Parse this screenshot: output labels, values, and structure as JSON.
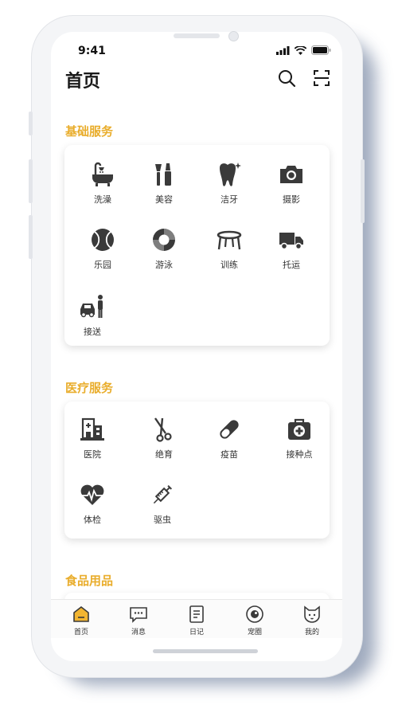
{
  "status_bar": {
    "time": "9:41"
  },
  "header": {
    "title": "首页",
    "icons": [
      "search-icon",
      "scan-icon"
    ]
  },
  "sections": [
    {
      "title": "基础服务",
      "items": [
        {
          "label": "洗澡",
          "icon": "bath-icon"
        },
        {
          "label": "美容",
          "icon": "beauty-icon"
        },
        {
          "label": "洁牙",
          "icon": "tooth-icon"
        },
        {
          "label": "摄影",
          "icon": "camera-icon"
        },
        {
          "label": "乐园",
          "icon": "ball-icon"
        },
        {
          "label": "游泳",
          "icon": "swim-ring-icon"
        },
        {
          "label": "训练",
          "icon": "trampoline-icon"
        },
        {
          "label": "托运",
          "icon": "truck-icon"
        },
        {
          "label": "接送",
          "icon": "pickup-icon"
        }
      ]
    },
    {
      "title": "医疗服务",
      "items": [
        {
          "label": "医院",
          "icon": "hospital-icon"
        },
        {
          "label": "绝育",
          "icon": "scissors-icon"
        },
        {
          "label": "疫苗",
          "icon": "pill-icon"
        },
        {
          "label": "接种点",
          "icon": "medkit-icon"
        },
        {
          "label": "体检",
          "icon": "heartbeat-icon"
        },
        {
          "label": "驱虫",
          "icon": "syringe-icon"
        }
      ]
    },
    {
      "title": "食品用品",
      "items": []
    }
  ],
  "tabbar": [
    {
      "label": "首页",
      "icon": "home-icon",
      "active": true
    },
    {
      "label": "消息",
      "icon": "message-icon",
      "active": false
    },
    {
      "label": "日记",
      "icon": "diary-icon",
      "active": false
    },
    {
      "label": "宠圈",
      "icon": "pet-circle-icon",
      "active": false
    },
    {
      "label": "我的",
      "icon": "cat-face-icon",
      "active": false
    }
  ],
  "colors": {
    "accent": "#e9ad2c",
    "icon": "#3a3a3a",
    "active_tab": "#f2b531"
  }
}
